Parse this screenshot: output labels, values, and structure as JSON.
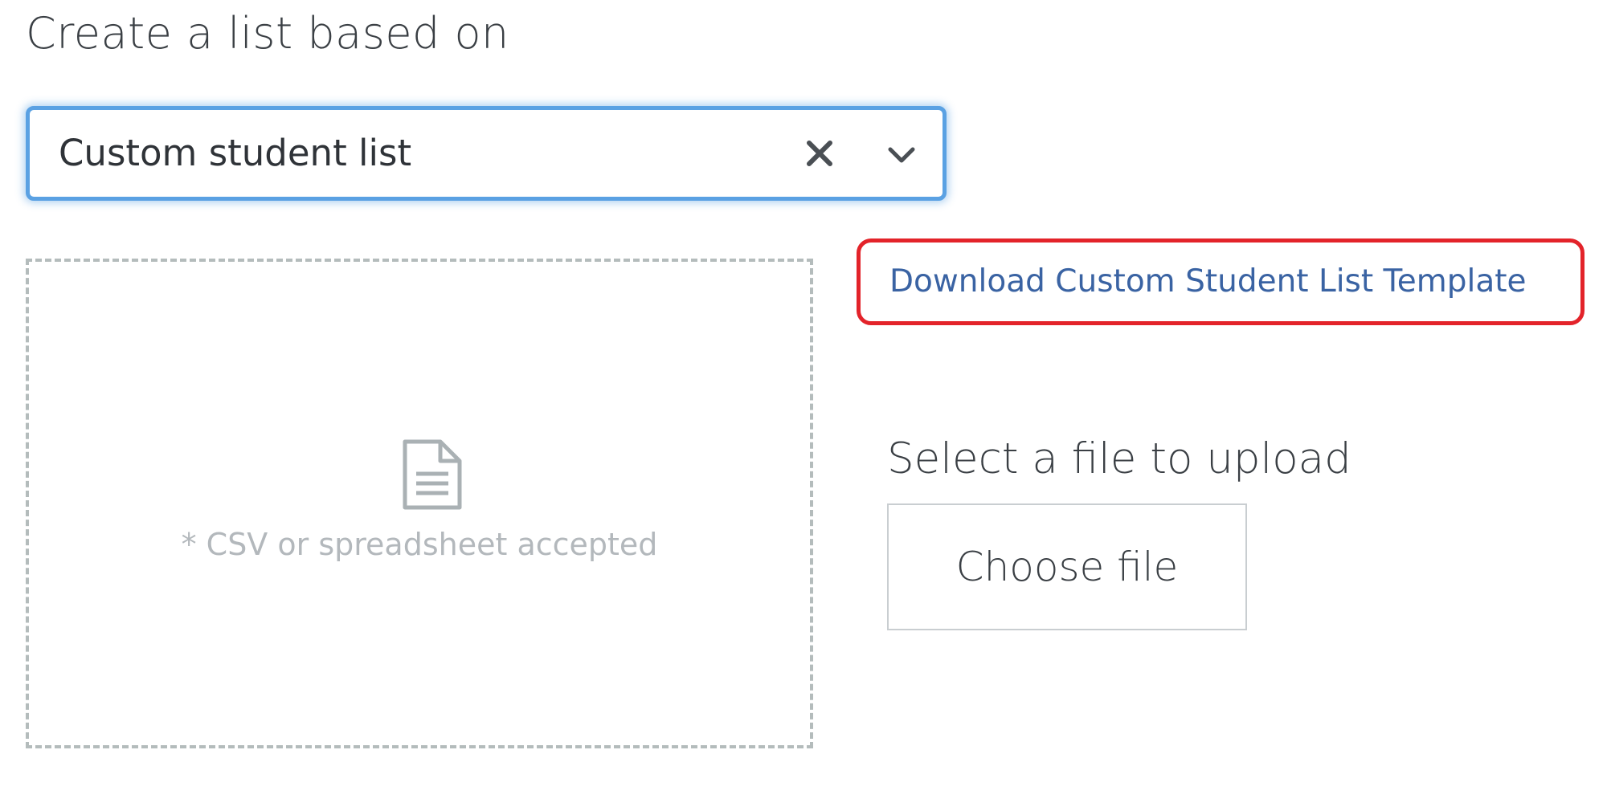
{
  "heading": "Create a list based on",
  "select": {
    "value": "Custom student list",
    "clear_icon": "close-icon",
    "toggle_icon": "chevron-down-icon",
    "focus_color": "#5aa1e3"
  },
  "dropzone": {
    "icon": "file-document-icon",
    "hint": "* CSV or spreadsheet accepted"
  },
  "download": {
    "label": "Download Custom Student List Template",
    "link_color": "#3a63a3",
    "highlight_color": "#e3232a"
  },
  "upload": {
    "label": "Select a file to upload",
    "button_label": "Choose file"
  }
}
